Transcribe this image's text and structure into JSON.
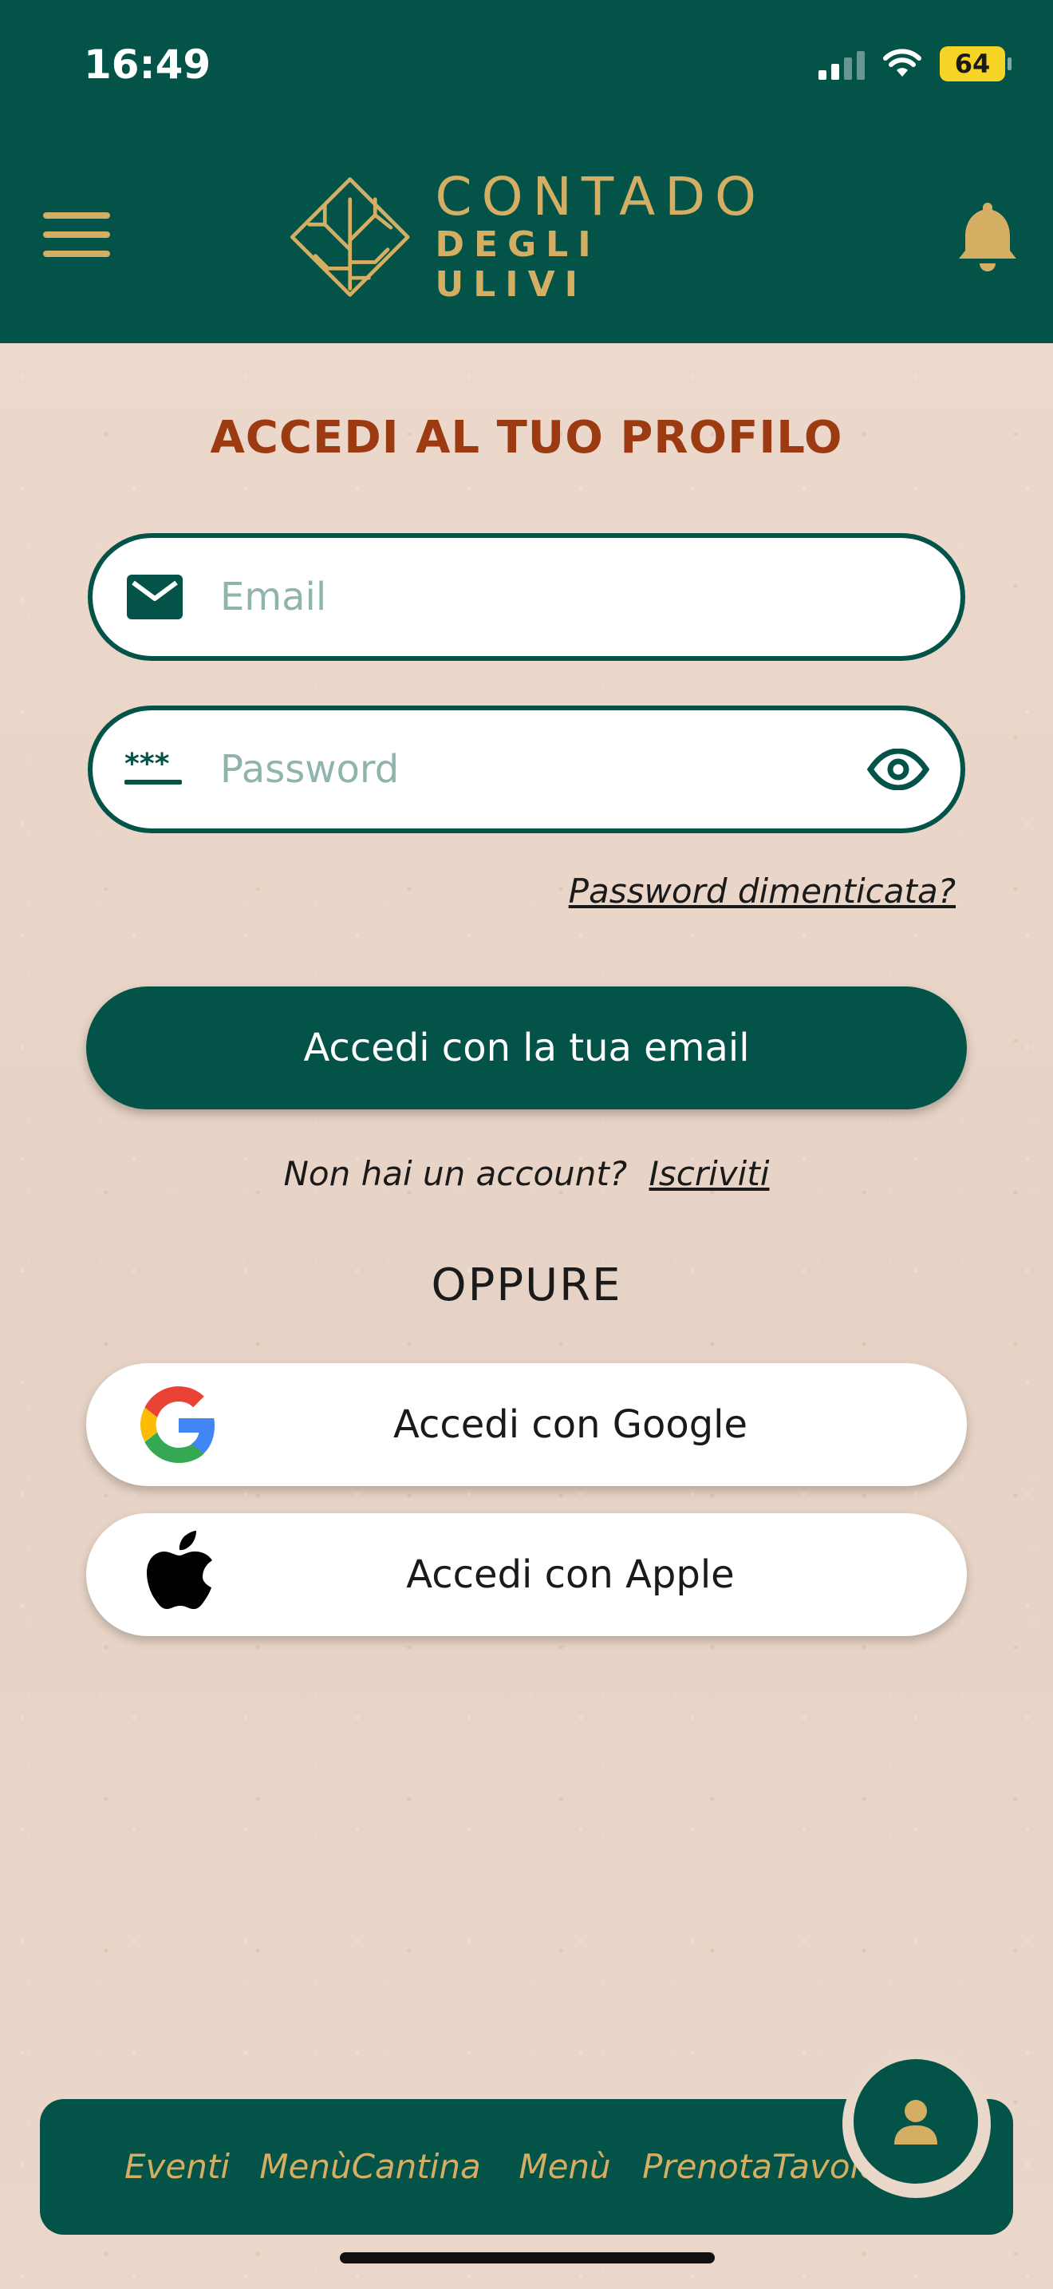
{
  "status_bar": {
    "time": "16:49",
    "battery": "64"
  },
  "header": {
    "logo_line1": "CONTADO",
    "logo_line2": "DEGLI ULIVI",
    "menu_icon": "hamburger-icon",
    "notifications_icon": "bell-icon"
  },
  "login": {
    "title": "ACCEDI AL TUO PROFILO",
    "email_placeholder": "Email",
    "email_value": "",
    "password_placeholder": "Password",
    "password_value": "",
    "forgot_label": "Password dimenticata?",
    "submit_label": "Accedi con la tua email",
    "no_account_text": "Non hai un account?",
    "signup_label": "Iscriviti",
    "or_label": "OPPURE",
    "google_label": "Accedi con Google",
    "apple_label": "Accedi con Apple"
  },
  "bottom_nav": {
    "items": [
      {
        "label": "Eventi"
      },
      {
        "label": "Menù Cantina"
      },
      {
        "label": "Menù"
      },
      {
        "label": "Prenota Tavolo"
      }
    ],
    "profile_icon": "user-icon"
  },
  "colors": {
    "primary": "#045348",
    "gold": "#d4ae62",
    "title": "#9c3a12",
    "background": "#e9d7c9"
  }
}
